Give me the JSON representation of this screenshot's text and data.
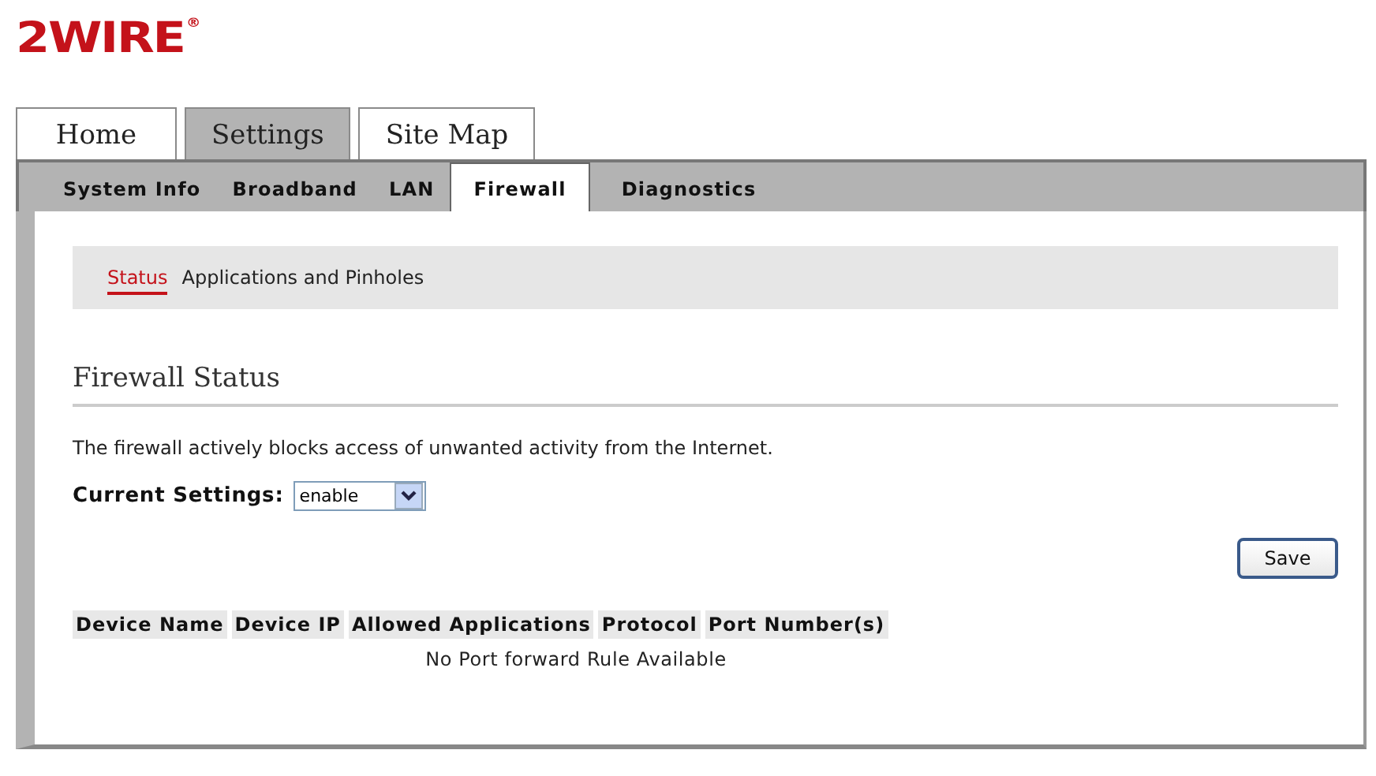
{
  "logo": {
    "text": "2WIRE",
    "mark": "®"
  },
  "main_tabs": [
    {
      "label": "Home",
      "selected": false
    },
    {
      "label": "Settings",
      "selected": true
    },
    {
      "label": "Site Map",
      "selected": false
    }
  ],
  "sub_tabs": [
    {
      "label": "System Info",
      "selected": false
    },
    {
      "label": "Broadband",
      "selected": false
    },
    {
      "label": "LAN",
      "selected": false
    },
    {
      "label": "Firewall",
      "selected": true
    },
    {
      "label": "Diagnostics",
      "selected": false
    }
  ],
  "section_nav": [
    {
      "label": "Status",
      "selected": true
    },
    {
      "label": "Applications and Pinholes",
      "selected": false
    }
  ],
  "heading": "Firewall Status",
  "description": "The firewall actively blocks access of unwanted activity from the Internet.",
  "setting": {
    "label": "Current Settings:",
    "value": "enable"
  },
  "save_button": "Save",
  "table": {
    "columns": [
      "Device Name",
      "Device IP",
      "Allowed Applications",
      "Protocol",
      "Port Number(s)"
    ],
    "empty_message": "No Port forward Rule Available"
  }
}
